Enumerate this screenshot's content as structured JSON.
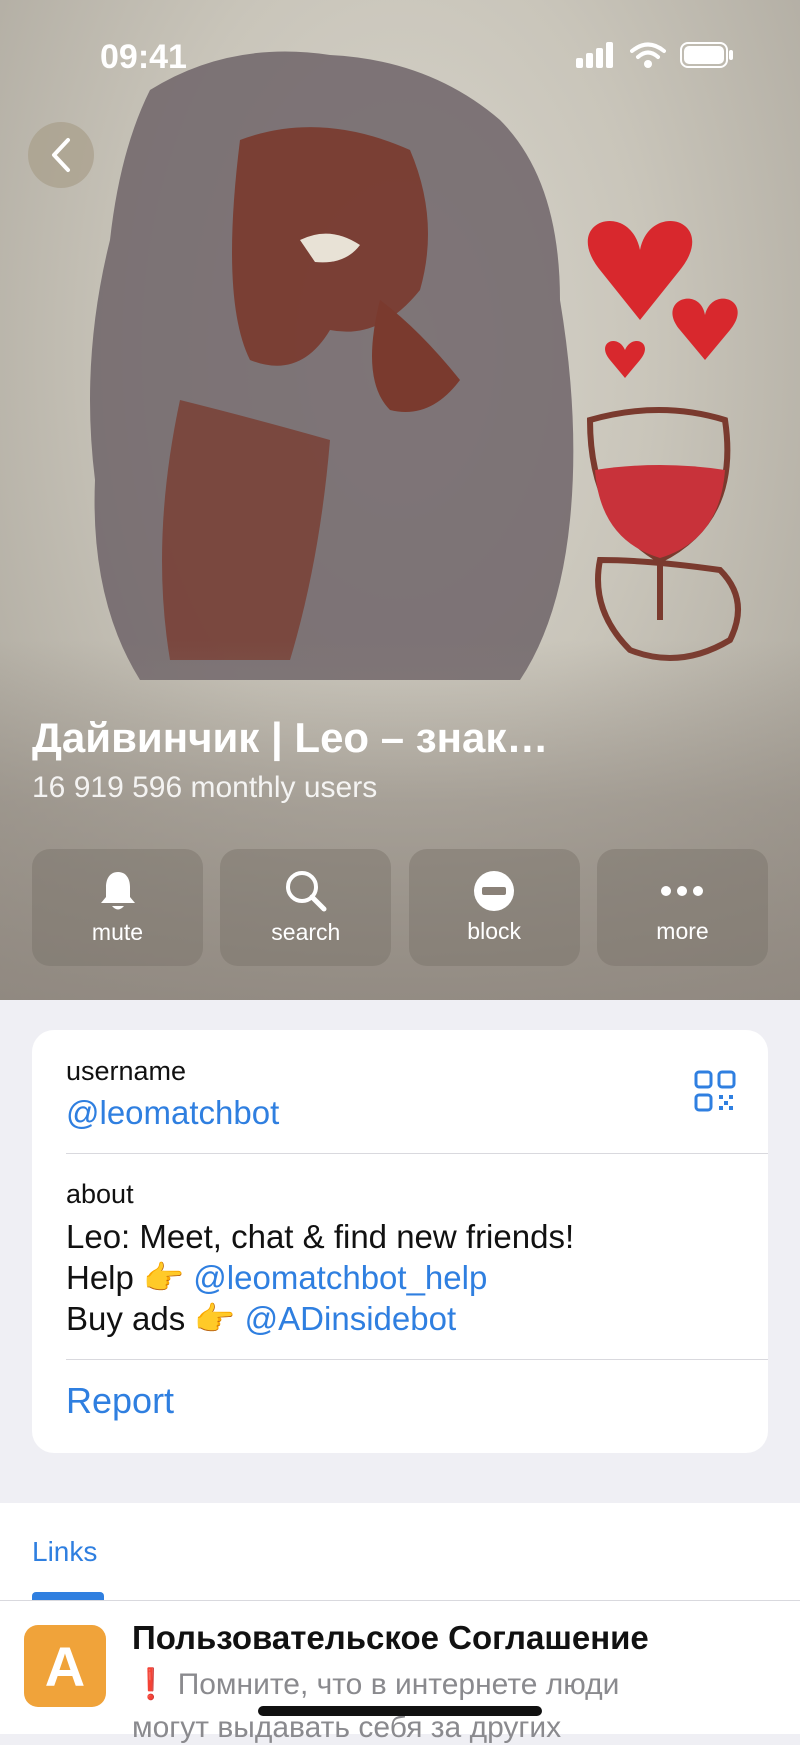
{
  "status_bar": {
    "time": "09:41",
    "icons": [
      "signal-icon",
      "wifi-icon",
      "battery-icon"
    ]
  },
  "header": {
    "title": "Дайвинчик | Leo – знак…",
    "subtitle": "16 919 596 monthly users",
    "back_icon": "chevron-left-icon"
  },
  "actions": [
    {
      "label": "mute",
      "icon": "bell-icon"
    },
    {
      "label": "search",
      "icon": "search-icon"
    },
    {
      "label": "block",
      "icon": "block-icon"
    },
    {
      "label": "more",
      "icon": "more-icon"
    }
  ],
  "info": {
    "username_label": "username",
    "username": "@leomatchbot",
    "about_label": "about",
    "about_line1": "Leo: Meet, chat & find new friends!",
    "about_line2_prefix": "Help 👉 ",
    "about_line2_link": "@leomatchbot_help",
    "about_line3_prefix": "Buy ads 👉 ",
    "about_line3_link": "@ADinsidebot",
    "report": "Report"
  },
  "links": {
    "tab_label": "Links",
    "items": [
      {
        "icon_letter": "A",
        "title": "Пользовательское Соглашение",
        "desc_line1": "❗ Помните, что в интернете люди",
        "desc_line2": "могут выдавать себя за других"
      }
    ]
  },
  "colors": {
    "accent": "#2f7fe0",
    "link_icon_bg": "#f0a33a"
  }
}
